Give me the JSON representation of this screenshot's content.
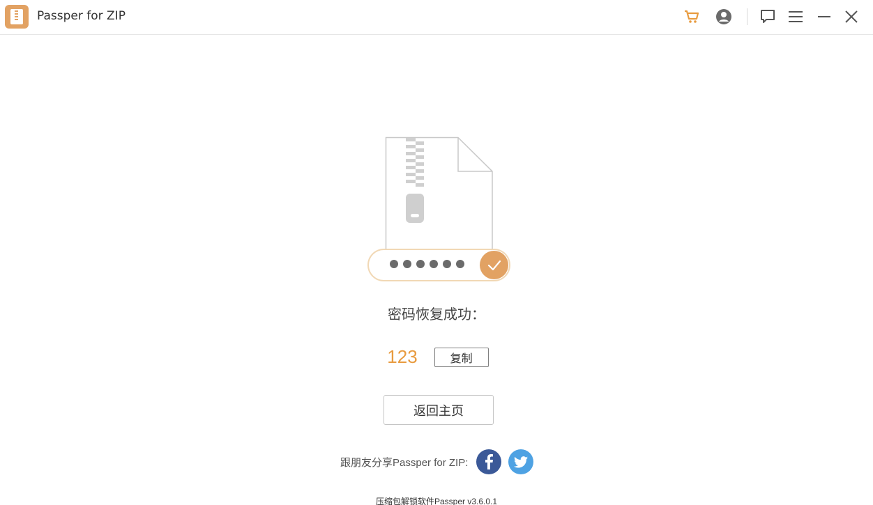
{
  "app": {
    "title": "Passper for ZIP"
  },
  "toolbar": {
    "icons": [
      "cart-icon",
      "account-icon",
      "feedback-icon",
      "menu-icon",
      "minimize-icon",
      "close-icon"
    ],
    "accent_color": "#e89b3f"
  },
  "result": {
    "message": "密码恢复成功：",
    "password": "123",
    "copy_label": "复制",
    "home_label": "返回主页"
  },
  "share": {
    "label": "跟朋友分享Passper for ZIP:",
    "icons": [
      "facebook-icon",
      "twitter-icon"
    ]
  },
  "footer": {
    "version": "压缩包解锁软件Passper  v3.6.0.1"
  },
  "colors": {
    "brand": "#e2a263",
    "password": "#e89b3f",
    "facebook": "#3b5998",
    "twitter": "#4ea2e3"
  }
}
